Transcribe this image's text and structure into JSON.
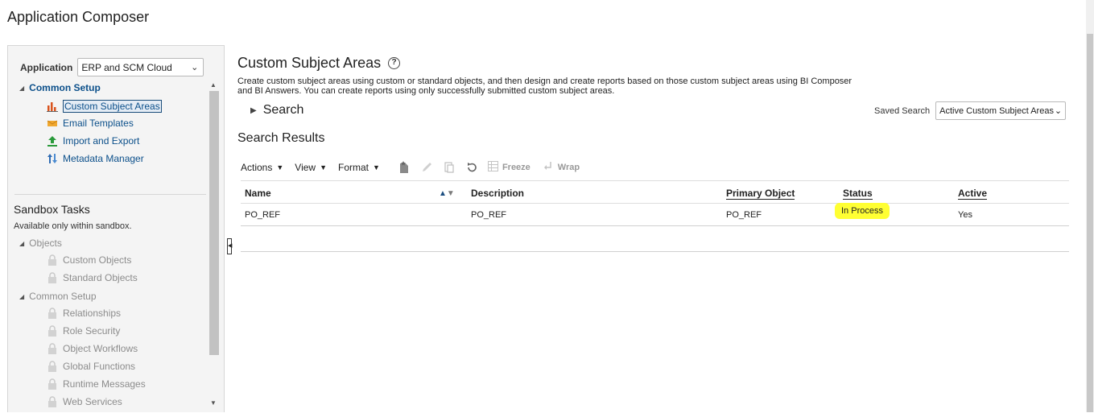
{
  "app": {
    "title": "Application Composer"
  },
  "sidebar": {
    "application_label": "Application",
    "application_value": "ERP and SCM Cloud",
    "common_setup": {
      "label": "Common Setup",
      "items": [
        {
          "label": "Custom Subject Areas",
          "icon": "bar-chart-icon",
          "selected": true
        },
        {
          "label": "Email Templates",
          "icon": "email-template-icon"
        },
        {
          "label": "Import and Export",
          "icon": "import-export-icon"
        },
        {
          "label": "Metadata Manager",
          "icon": "metadata-manager-icon"
        }
      ]
    },
    "sandbox": {
      "title": "Sandbox Tasks",
      "note": "Available only within sandbox.",
      "objects_label": "Objects",
      "objects_items": [
        "Custom Objects",
        "Standard Objects"
      ],
      "common_setup_label": "Common Setup",
      "common_setup_items": [
        "Relationships",
        "Role Security",
        "Object Workflows",
        "Global Functions",
        "Runtime Messages",
        "Web Services"
      ]
    }
  },
  "main": {
    "title": "Custom Subject Areas",
    "description": "Create custom subject areas using custom or standard objects, and then design and create reports based on those custom subject areas using BI Composer and BI Answers. You can create reports using only successfully submitted custom subject areas.",
    "search_label": "Search",
    "saved_search_label": "Saved Search",
    "saved_search_value": "Active Custom Subject Areas",
    "results_title": "Search Results",
    "toolbar": {
      "actions": "Actions",
      "view": "View",
      "format": "Format",
      "freeze": "Freeze",
      "wrap": "Wrap"
    },
    "table": {
      "columns": [
        "Name",
        "Description",
        "Primary Object",
        "Status",
        "Active"
      ],
      "rows": [
        {
          "name": "PO_REF",
          "description": "PO_REF",
          "primary_object": "PO_REF",
          "status": "In Process",
          "active": "Yes"
        }
      ]
    }
  },
  "colors": {
    "link": "#0b4f8a",
    "highlight": "#ffff33",
    "disabled": "#8c8c8c"
  }
}
